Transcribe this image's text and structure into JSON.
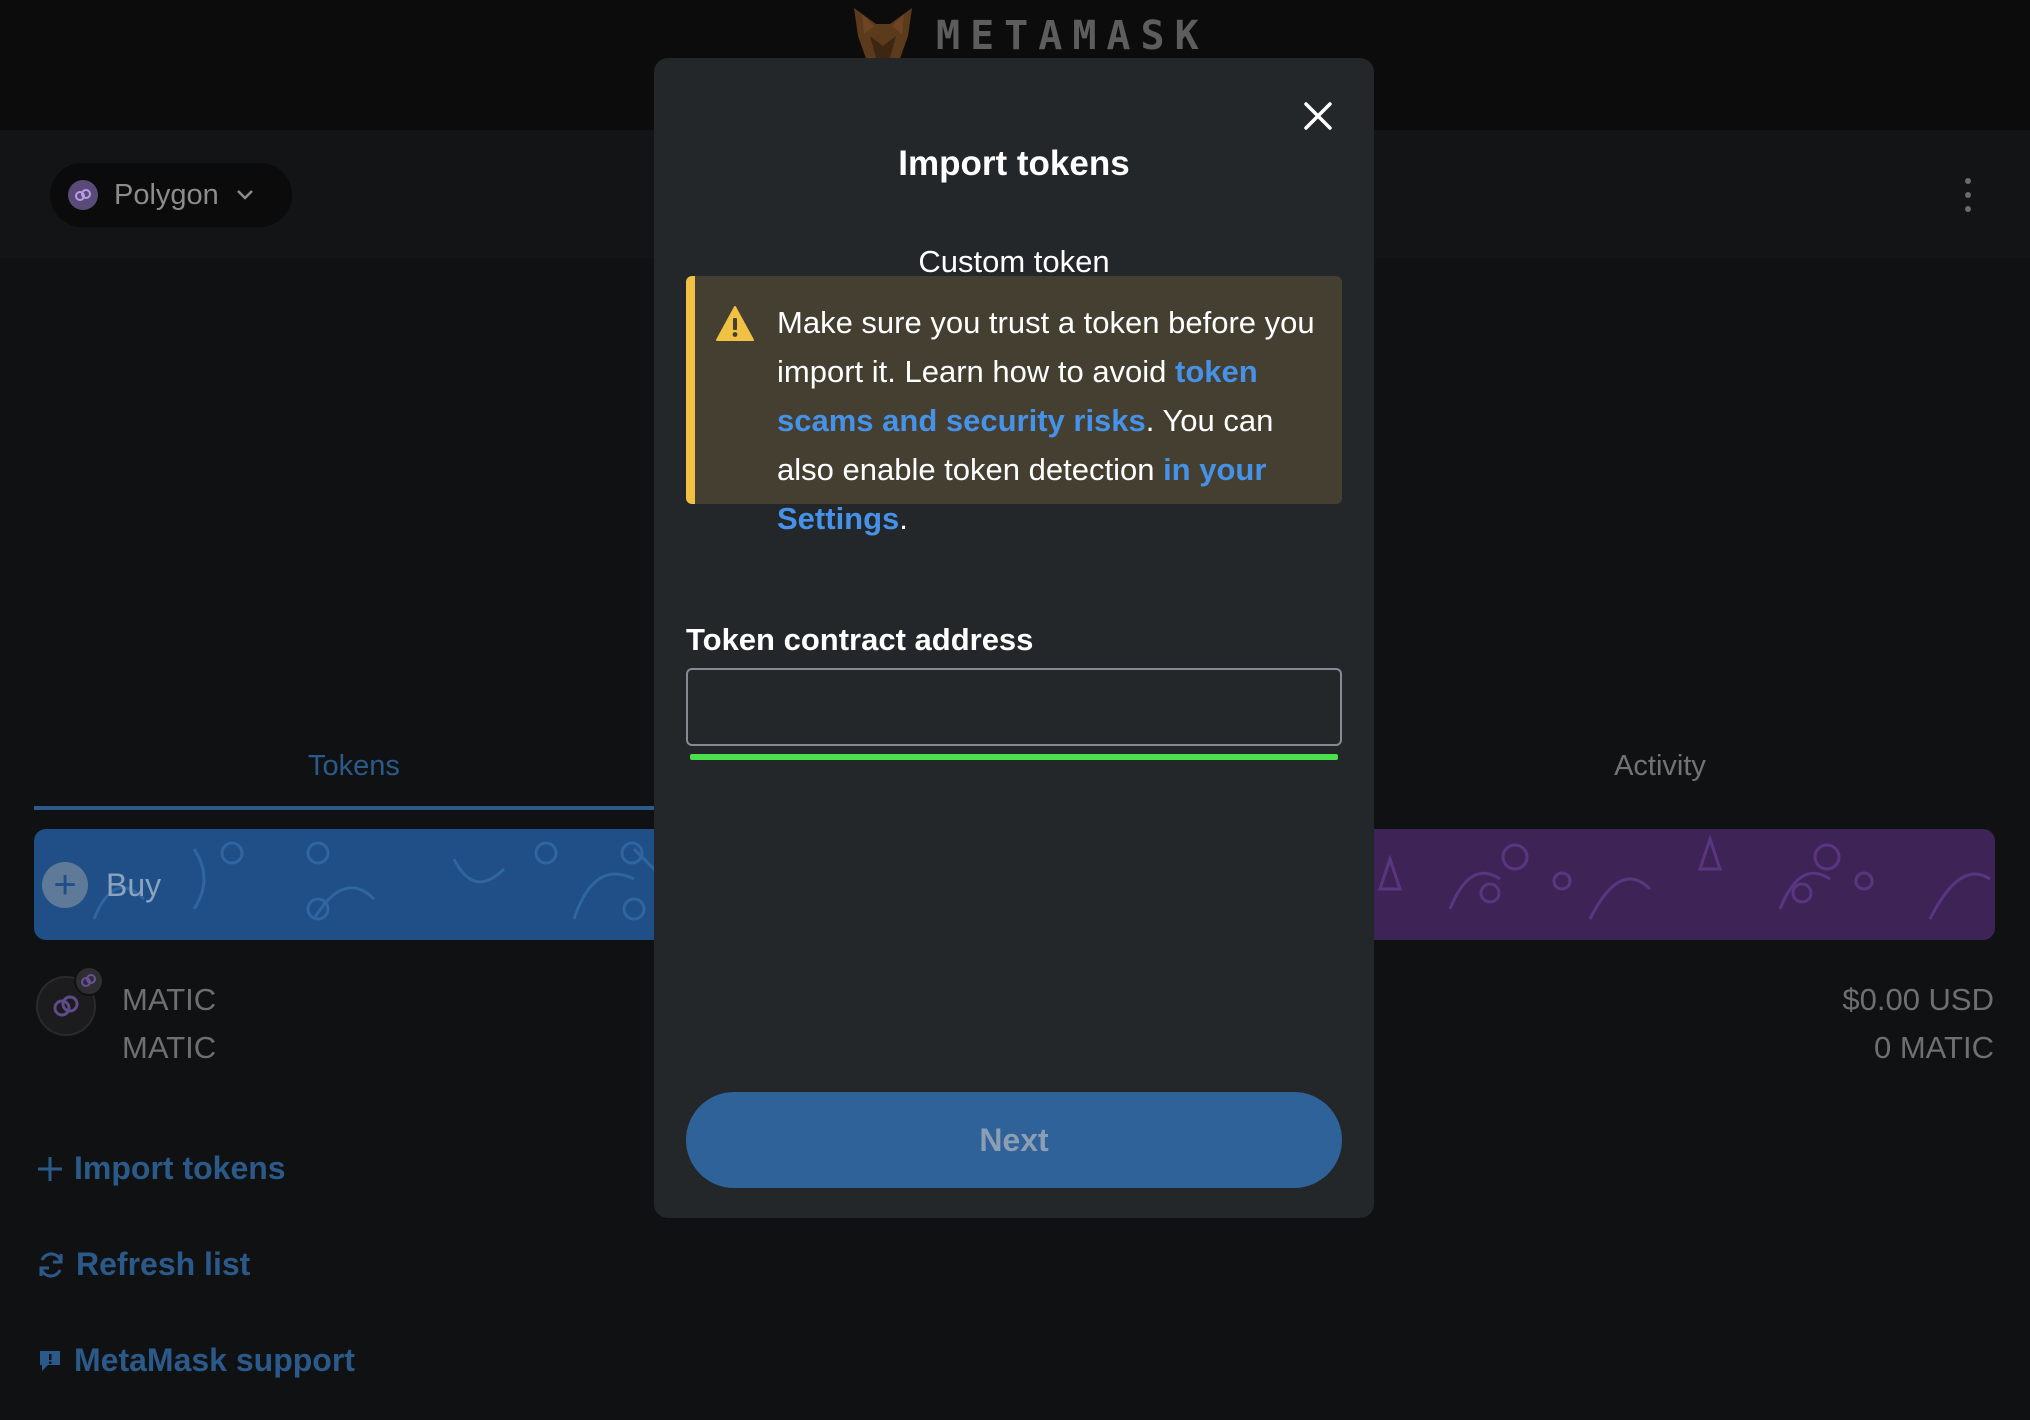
{
  "app": {
    "logo_text": "METAMASK",
    "network": "Polygon",
    "tabs": [
      {
        "label": "Tokens",
        "active": true
      },
      {
        "label": "Activity",
        "active": false
      }
    ],
    "buy_label": "Buy",
    "token": {
      "name": "MATIC",
      "symbol": "MATIC",
      "usd_value": "$0.00 USD",
      "amount": "0 MATIC"
    },
    "links": {
      "import": "Import tokens",
      "refresh": "Refresh list",
      "support": "MetaMask support"
    }
  },
  "modal": {
    "title": "Import tokens",
    "subtitle": "Custom token",
    "warning": {
      "part1": "Make sure you trust a token before you import it. Learn how to avoid ",
      "link1": "token scams and security risks",
      "part2": ". You can also enable token detection ",
      "link2": "in your Settings",
      "part3": "."
    },
    "field_label": "Token contract address",
    "field_value": "",
    "next_label": "Next"
  },
  "colors": {
    "accent_blue": "#4592e8",
    "warning_yellow": "#f0c142",
    "progress_green": "#4be04b",
    "button_blue": "#2e6298"
  },
  "icons": [
    "fox-logo-icon",
    "polygon-icon",
    "chevron-down-icon",
    "kebab-menu-icon",
    "plus-icon",
    "close-icon",
    "warning-icon",
    "refresh-icon",
    "chat-icon"
  ]
}
